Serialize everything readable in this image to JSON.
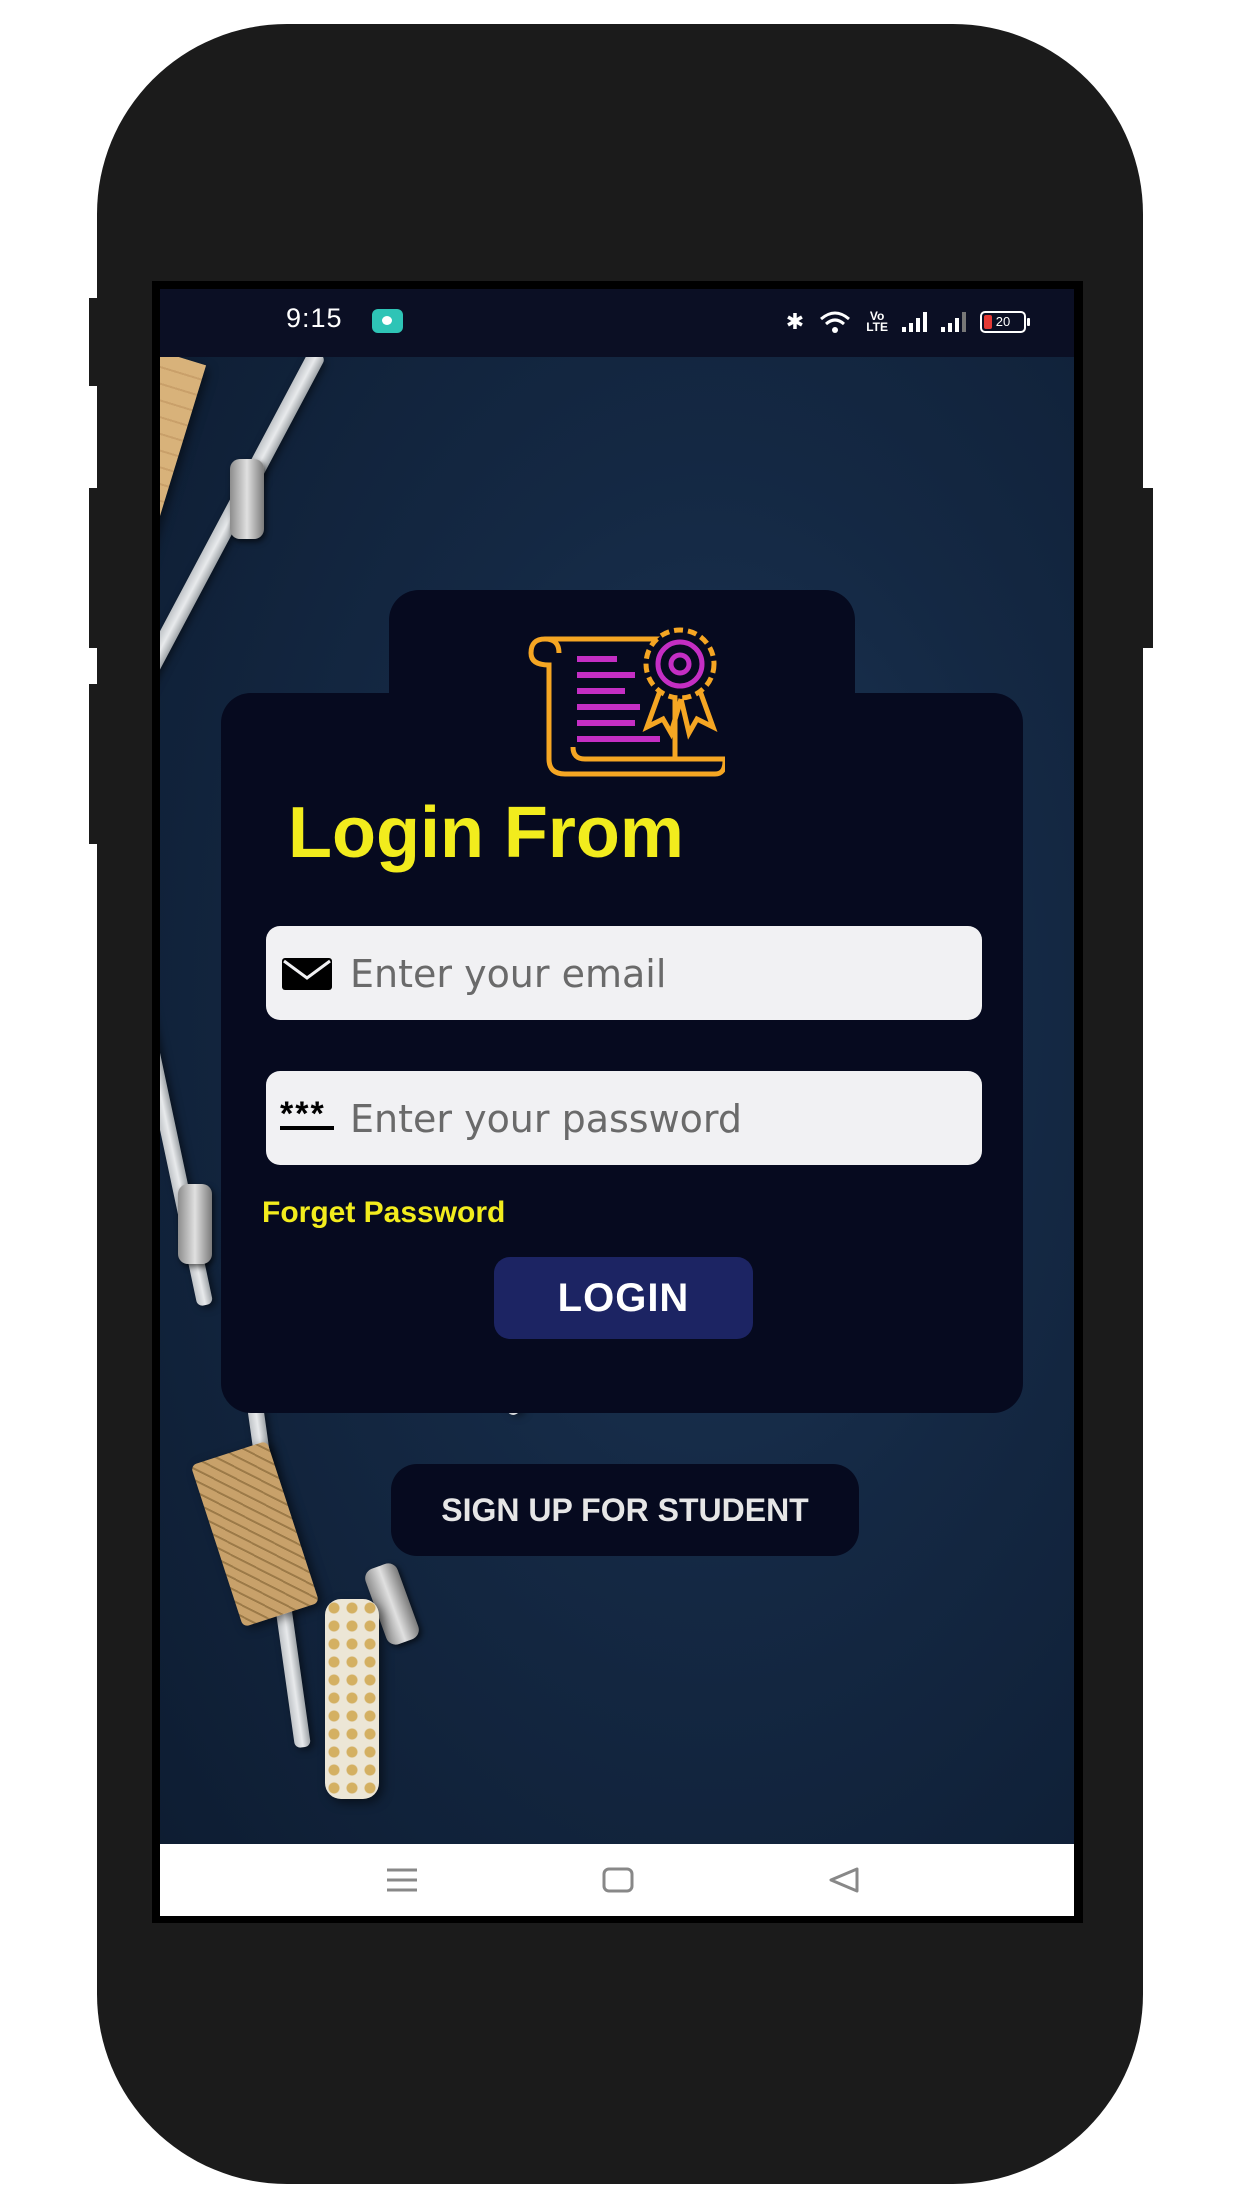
{
  "status_bar": {
    "time": "9:15",
    "volte": "Vo\nLTE",
    "battery": "20"
  },
  "login": {
    "title": "Login From",
    "email_placeholder": "Enter your email",
    "password_placeholder": "Enter your password",
    "password_icon_text": "***",
    "forget_password": "Forget Password",
    "login_button": "LOGIN"
  },
  "signup_button": "SIGN UP FOR STUDENT",
  "nav": {
    "icons": [
      "menu-icon",
      "home-icon",
      "back-icon"
    ]
  },
  "colors": {
    "accent_yellow": "#f2ec1d",
    "card_bg": "#060a1f",
    "login_button_bg": "#1c2463",
    "icon_magenta": "#c42ec4",
    "icon_orange": "#f5a623"
  }
}
